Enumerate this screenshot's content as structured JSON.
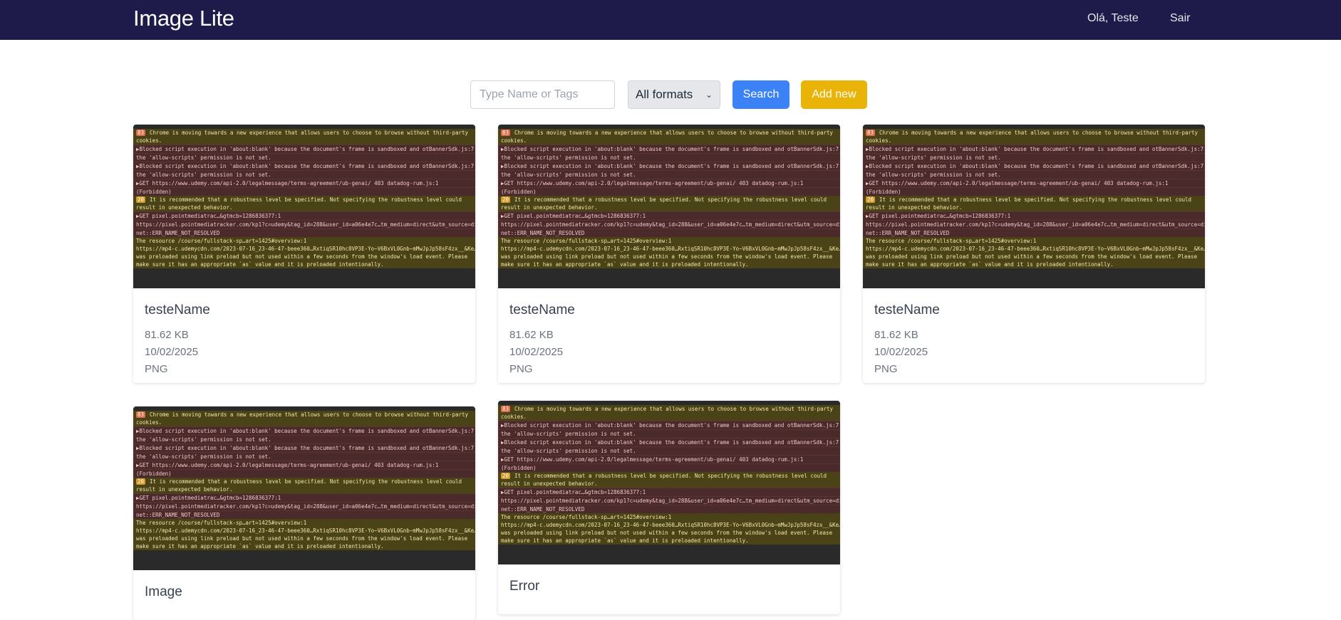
{
  "app": {
    "brand": "Image Lite",
    "greeting": "Olá, Teste",
    "logout": "Sair"
  },
  "toolbar": {
    "search_placeholder": "Type Name or Tags",
    "format_selected": "All formats",
    "search_label": "Search",
    "add_label": "Add new"
  },
  "console": [
    {
      "kind": "warn",
      "badge": "83",
      "text": "Chrome is moving towards a new experience that allows users to choose to browse without third-party"
    },
    {
      "kind": "warn",
      "badge": "",
      "text": "    cookies."
    },
    {
      "kind": "err",
      "badge": "",
      "text": "▶Blocked script execution in 'about:blank' because the document's frame is sandboxed and   otBannerSdk.js:7"
    },
    {
      "kind": "err",
      "badge": "",
      "text": "the 'allow-scripts' permission is not set."
    },
    {
      "kind": "err",
      "badge": "",
      "text": "▶Blocked script execution in 'about:blank' because the document's frame is sandboxed and   otBannerSdk.js:7"
    },
    {
      "kind": "err",
      "badge": "",
      "text": "the 'allow-scripts' permission is not set."
    },
    {
      "kind": "err",
      "badge": "",
      "text": "▶GET https://www.udemy.com/api-2.0/legalmessage/terms-agreement/ub-genai/ 403        datadog-rum.js:1"
    },
    {
      "kind": "err",
      "badge": "",
      "text": "(Forbidden)"
    },
    {
      "kind": "warn",
      "badge": "20",
      "text": "It is recommended that a robustness level be specified. Not specifying the robustness level could"
    },
    {
      "kind": "warn",
      "badge": "",
      "text": "    result in unexpected behavior."
    },
    {
      "kind": "err",
      "badge": "",
      "text": "▶GET                                                    pixel.pointmediatrac…&gtmcb=1286836377:1"
    },
    {
      "kind": "err",
      "badge": "",
      "text": "https://pixel.pointmediatracker.com/kp1?c=udemy&tag_id=288&user_id=a06e4e7c…tm_medium=direct&utm_source=di…"
    },
    {
      "kind": "err",
      "badge": "",
      "text": "net::ERR_NAME_NOT_RESOLVED"
    },
    {
      "kind": "warn",
      "badge": "",
      "text": "The resource                                            /course/fullstack-sp…art=1425#overview:1"
    },
    {
      "kind": "warn",
      "badge": "",
      "text": "https://mp4-c.udemycdn.com/2023-07-16_23-46-47-beee360…RxtiqSR10hc8VP3E-Yo~V6BxVL0Gnb~mMwJpJp58sF4zx__&Ke…"
    },
    {
      "kind": "warn",
      "badge": "",
      "text": "was preloaded using link preload but not used within a few seconds from the window's load event. Please"
    },
    {
      "kind": "warn",
      "badge": "",
      "text": "make sure it has an appropriate `as` value and it is preloaded intentionally."
    }
  ],
  "cards": [
    {
      "name": "testeName",
      "size": "81.62 KB",
      "date": "10/02/2025",
      "format": "PNG"
    },
    {
      "name": "testeName",
      "size": "81.62 KB",
      "date": "10/02/2025",
      "format": "PNG"
    },
    {
      "name": "testeName",
      "size": "81.62 KB",
      "date": "10/02/2025",
      "format": "PNG"
    },
    {
      "name": "Image",
      "size": "",
      "date": "",
      "format": ""
    },
    {
      "name": "Error",
      "size": "",
      "date": "",
      "format": ""
    }
  ]
}
